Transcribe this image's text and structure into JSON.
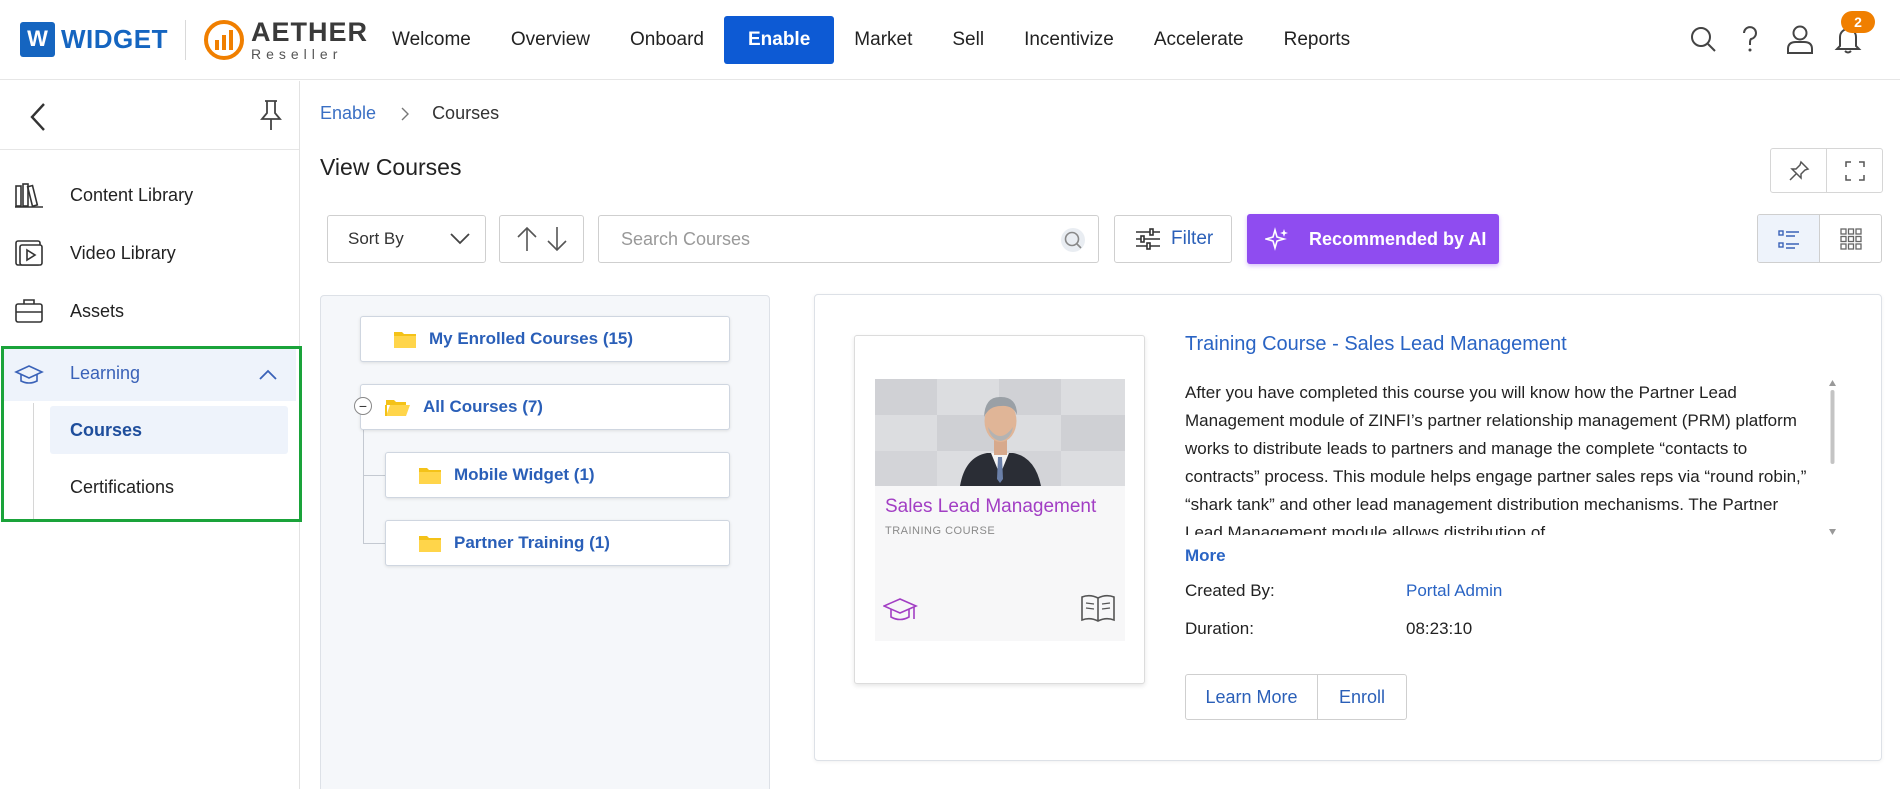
{
  "brand": {
    "widget_letter": "W",
    "widget_name": "WIDGET",
    "aether_name": "AETHER",
    "aether_sub": "Reseller"
  },
  "nav": {
    "items": [
      {
        "label": "Welcome"
      },
      {
        "label": "Overview"
      },
      {
        "label": "Onboard"
      },
      {
        "label": "Enable",
        "active": true
      },
      {
        "label": "Market"
      },
      {
        "label": "Sell"
      },
      {
        "label": "Incentivize"
      },
      {
        "label": "Accelerate"
      },
      {
        "label": "Reports"
      }
    ],
    "notification_count": "2"
  },
  "sidebar": {
    "items": [
      {
        "label": "Content Library",
        "icon": "books-icon"
      },
      {
        "label": "Video Library",
        "icon": "video-icon"
      },
      {
        "label": "Assets",
        "icon": "briefcase-icon"
      },
      {
        "label": "Learning",
        "icon": "graduation-cap-icon",
        "expanded": true
      }
    ],
    "learning_children": [
      {
        "label": "Courses",
        "active": true
      },
      {
        "label": "Certifications"
      }
    ]
  },
  "breadcrumb": {
    "parent": "Enable",
    "current": "Courses"
  },
  "page": {
    "title": "View Courses"
  },
  "toolbar": {
    "sort_label": "Sort By",
    "search_placeholder": "Search Courses",
    "filter_label": "Filter",
    "ai_label": "Recommended by AI"
  },
  "tree": {
    "enrolled": "My Enrolled Courses (15)",
    "all": "All Courses (7)",
    "children": [
      "Mobile Widget (1)",
      "Partner Training (1)"
    ]
  },
  "course": {
    "title": "Training Course - Sales Lead Management",
    "description": "After you have completed this course you will know how the Partner Lead Management module of ZINFI’s partner relationship management (PRM) platform works to distribute leads to partners and manage the complete “contacts to contracts” process. This module helps engage partner sales reps via “round robin,” “shark tank” and other lead management distribution mechanisms. The Partner Lead Management module allows distribution of",
    "more_label": "More",
    "thumb_title": "Sales Lead Management",
    "thumb_subtitle": "TRAINING COURSE",
    "created_by_label": "Created By:",
    "created_by": "Portal Admin",
    "duration_label": "Duration:",
    "duration": "08:23:10",
    "learn_more_label": "Learn More",
    "enroll_label": "Enroll"
  },
  "colors": {
    "primary": "#0d5ad4",
    "link": "#2a64c4",
    "ai": "#8f4cf0",
    "highlight_border": "#1aa33a",
    "badge": "#f07f00",
    "thumb_title": "#a23ec4"
  }
}
